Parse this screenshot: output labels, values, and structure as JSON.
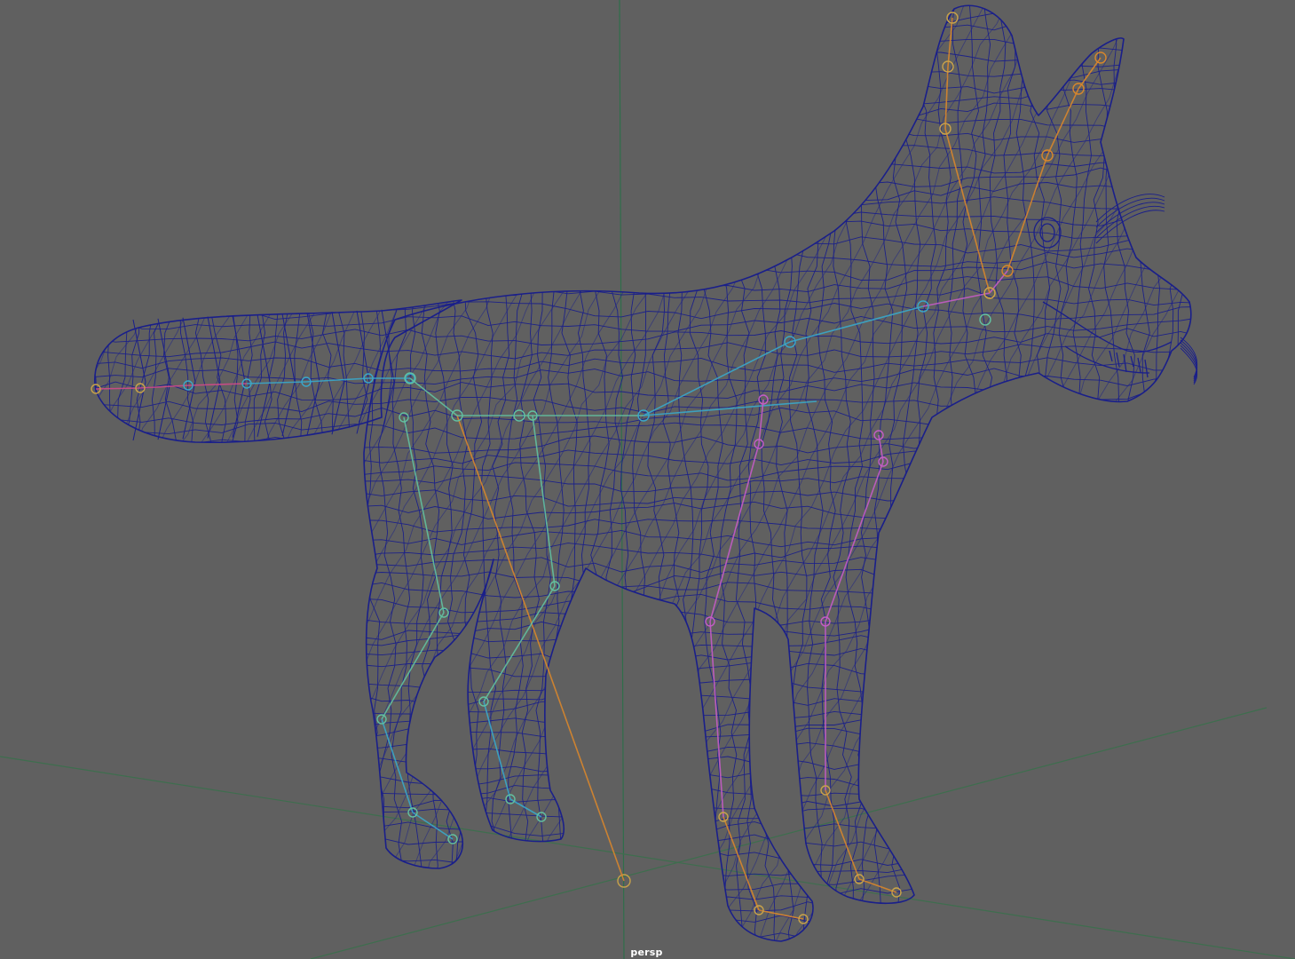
{
  "viewport": {
    "camera_name": "persp",
    "display_mode": "wireframe",
    "background_color": "#606060"
  },
  "colors": {
    "grid_x_axis": "#3e6e4e",
    "grid_z_axis": "#3e6e4e",
    "grid_y_axis": "#2f6e4a",
    "wireframe": "#1a1f8a",
    "skeleton_spine": "#3aa7c9",
    "skeleton_hind": "#62c0a0",
    "skeleton_front": "#c45cc7",
    "skeleton_tail": "#d04a8a",
    "skeleton_head": "#d8862c",
    "skeleton_root": "#c8a24a"
  },
  "scene": {
    "model": "fox",
    "objects": [
      "grid-origin",
      "fox-wireframe-mesh",
      "fox-skeleton"
    ]
  }
}
